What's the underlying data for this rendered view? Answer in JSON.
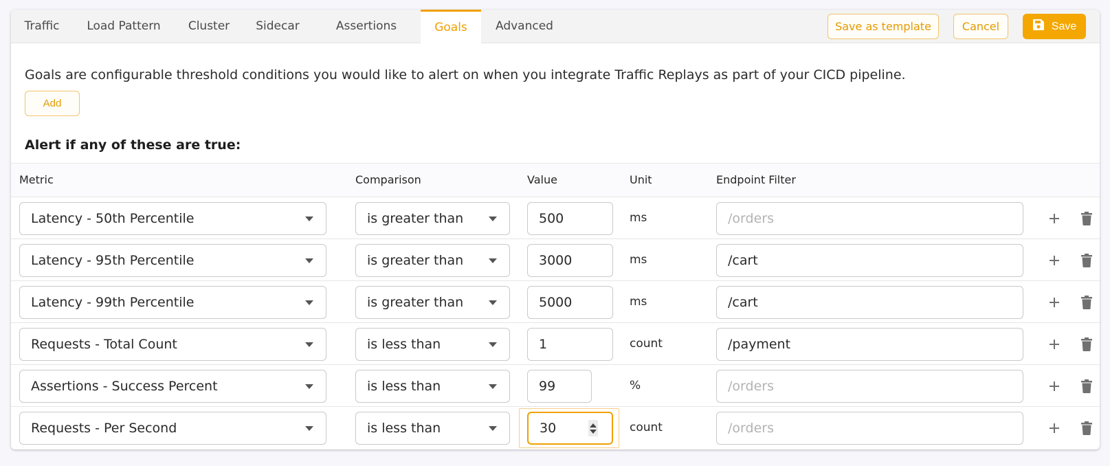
{
  "tabs": [
    {
      "label": "Traffic"
    },
    {
      "label": "Load Pattern"
    },
    {
      "label": "Cluster"
    },
    {
      "label": "Sidecar"
    },
    {
      "label": "Assertions"
    },
    {
      "label": "Goals"
    },
    {
      "label": "Advanced"
    }
  ],
  "active_tab": "Goals",
  "toolbar": {
    "save_template_label": "Save as template",
    "cancel_label": "Cancel",
    "save_label": "Save"
  },
  "description": "Goals are configurable threshold conditions you would like to alert on when you integrate Traffic Replays as part of your CICD pipeline.",
  "add_label": "Add",
  "alert_heading": "Alert if any of these are true:",
  "columns": {
    "metric": "Metric",
    "comparison": "Comparison",
    "value": "Value",
    "unit": "Unit",
    "endpoint": "Endpoint Filter"
  },
  "rows": [
    {
      "metric": "Latency - 50th Percentile",
      "comparison": "is greater than",
      "value": "500",
      "unit": "ms",
      "endpoint_value": "",
      "endpoint_placeholder": "/orders"
    },
    {
      "metric": "Latency - 95th Percentile",
      "comparison": "is greater than",
      "value": "3000",
      "unit": "ms",
      "endpoint_value": "/cart",
      "endpoint_placeholder": ""
    },
    {
      "metric": "Latency - 99th Percentile",
      "comparison": "is greater than",
      "value": "5000",
      "unit": "ms",
      "endpoint_value": "/cart",
      "endpoint_placeholder": ""
    },
    {
      "metric": "Requests - Total Count",
      "comparison": "is less than",
      "value": "1",
      "unit": "count",
      "endpoint_value": "/payment",
      "endpoint_placeholder": ""
    },
    {
      "metric": "Assertions - Success Percent",
      "comparison": "is less than",
      "value": "99",
      "unit": "%",
      "endpoint_value": "",
      "endpoint_placeholder": "/orders"
    },
    {
      "metric": "Requests - Per Second",
      "comparison": "is less than",
      "value": "30",
      "unit": "count",
      "endpoint_value": "",
      "endpoint_placeholder": "/orders"
    }
  ],
  "colors": {
    "accent": "#f0a000",
    "save_bg": "#f4a700",
    "outline_border": "#f2c36b",
    "icon_gray": "#707070"
  },
  "icons": {
    "save": "floppy-disk-icon",
    "add_row": "plus-icon",
    "delete_row": "trash-icon",
    "dropdown": "chevron-down-icon"
  }
}
